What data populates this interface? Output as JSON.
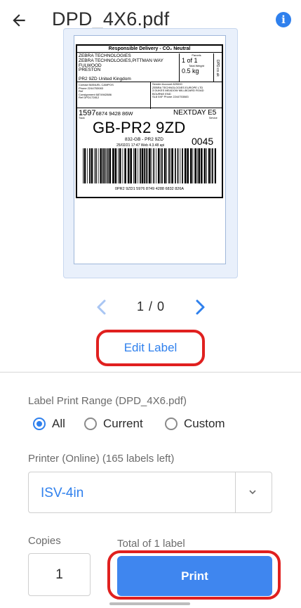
{
  "header": {
    "title": "DPD_4X6.pdf",
    "back_icon": "arrow-left-icon",
    "info_icon": "info-icon"
  },
  "label_preview": {
    "banner": "Responsible Delivery - CO₂ Neutral",
    "sender_lines": [
      "ZEBRA TECHNOLOGIES",
      "ZEBRA TECHNOLOGIES,PITTMAN WAY",
      "FULWOOD",
      "PRESTON"
    ],
    "postcode_country": "PR2 9ZD        United Kingdom",
    "parcels_label": "Parcels",
    "parcels_value": "1 of 1",
    "weight_label": "Total Weight",
    "weight_value": "0.5 kg",
    "side_text": "DPD.co.uk",
    "contact_lines": [
      "Contact  MANUEL CAMPOS",
      "Phone  2244753083",
      "Ref",
      "",
      "Consignment  6874942886",
      "Ref  DPD172812"
    ],
    "right_lines": [
      "Sender    Account 829000",
      "ZEBRA TECHNOLOGIES EUROPE LTD",
      "3 DUKES MEADOW MILLBOARD ROAD",
      "",
      "BOURNE END",
      "",
      "SL8 5XF        Phone 2244753083"
    ],
    "tracking_prefix": "1597",
    "tracking_rest": "6874 9428 86W",
    "service": "NEXTDAY E5",
    "tiny_left": "Track",
    "tiny_right": "Service",
    "route_big": "GB-PR2 9ZD",
    "route_small": "832-GB - PR2 9ZD",
    "route_num": "0045",
    "date_line": "25/02/21 17:47  Web 4.3.48  api",
    "barcode_text": "0PR2 9ZD1 5976 8749 4288 6832 826A"
  },
  "pager": {
    "text": "1 / 0",
    "prev_icon": "chevron-left-icon",
    "next_icon": "chevron-right-icon"
  },
  "edit_label": "Edit Label",
  "range": {
    "label": "Label Print Range (DPD_4X6.pdf)",
    "options": [
      {
        "label": "All",
        "checked": true
      },
      {
        "label": "Current",
        "checked": false
      },
      {
        "label": "Custom",
        "checked": false
      }
    ]
  },
  "printer": {
    "label": "Printer (Online) (165 labels left)",
    "value": "ISV-4in",
    "chevron_icon": "chevron-down-icon"
  },
  "copies": {
    "label": "Copies",
    "value": "1"
  },
  "total_label": "Total of 1 label",
  "print_button": "Print",
  "colors": {
    "accent": "#2f80ed",
    "highlight": "#e0201f",
    "print_button": "#3f86ef"
  }
}
